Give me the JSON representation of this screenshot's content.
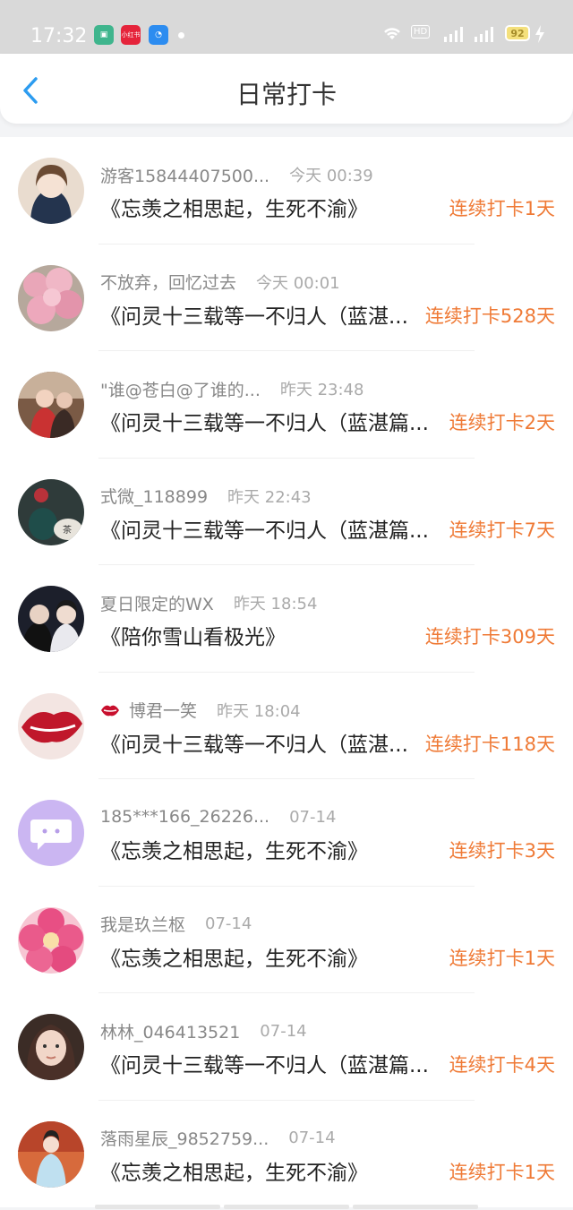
{
  "status_bar": {
    "time": "17:32",
    "app_icon_2_text": "小红书",
    "battery": "92"
  },
  "header": {
    "title": "日常打卡"
  },
  "items": [
    {
      "username": "游客15844407500...",
      "time": "今天 00:39",
      "content": "《忘羡之相思起，生死不渝》",
      "streak": "连续打卡1天"
    },
    {
      "username": "不放弃，回忆过去",
      "time": "今天 00:01",
      "content": "《问灵十三载等一不归人（蓝湛...",
      "streak": "连续打卡528天"
    },
    {
      "username": "\"谁@苍白@了谁的...",
      "time": "昨天 23:48",
      "content": "《问灵十三载等一不归人（蓝湛篇...",
      "streak": "连续打卡2天"
    },
    {
      "username": "式微_118899",
      "time": "昨天 22:43",
      "content": "《问灵十三载等一不归人（蓝湛篇...",
      "streak": "连续打卡7天"
    },
    {
      "username": "夏日限定的WX",
      "time": "昨天 18:54",
      "content": "《陪你雪山看极光》",
      "streak": "连续打卡309天"
    },
    {
      "username": "博君一笑",
      "time": "昨天 18:04",
      "content": "《问灵十三载等一不归人（蓝湛...",
      "streak": "连续打卡118天"
    },
    {
      "username": "185***166_26226...",
      "time": "07-14",
      "content": "《忘羡之相思起，生死不渝》",
      "streak": "连续打卡3天"
    },
    {
      "username": "我是玖兰枢",
      "time": "07-14",
      "content": "《忘羡之相思起，生死不渝》",
      "streak": "连续打卡1天"
    },
    {
      "username": "林林_046413521",
      "time": "07-14",
      "content": "《问灵十三载等一不归人（蓝湛篇...",
      "streak": "连续打卡4天"
    },
    {
      "username": "落雨星辰_9852759...",
      "time": "07-14",
      "content": "《忘羡之相思起，生死不渝》",
      "streak": "连续打卡1天"
    }
  ],
  "colors": {
    "streak": "#ef7a36",
    "accent": "#2c9cf0"
  }
}
